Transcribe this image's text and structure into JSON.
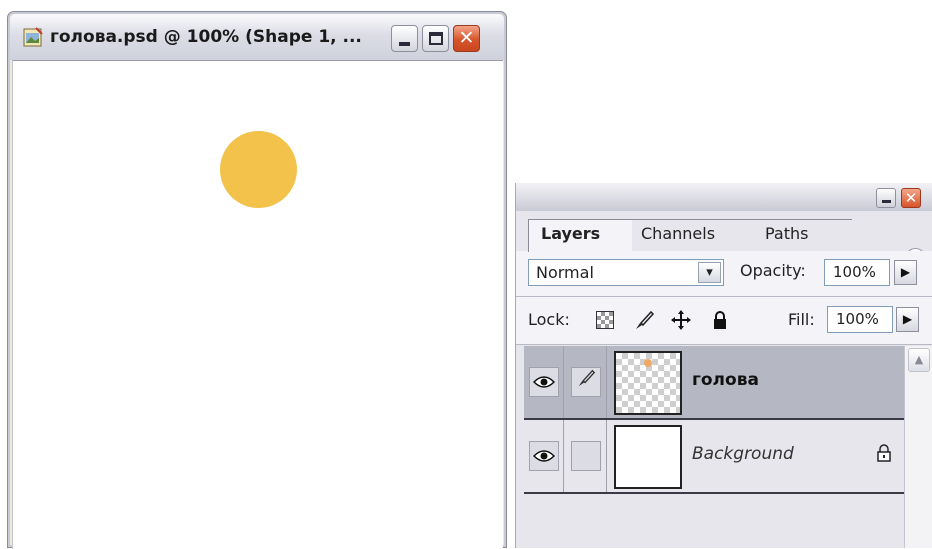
{
  "document": {
    "title": "голова.psd @ 100% (Shape 1, ...",
    "circle_color": "#f2c24a",
    "icons": {
      "app": "photoshop-document-icon",
      "minimize": "minimize-icon",
      "maximize": "maximize-icon",
      "close": "close-icon"
    }
  },
  "palette": {
    "tabs": [
      {
        "label": "Layers",
        "active": true
      },
      {
        "label": "Channels",
        "active": false
      },
      {
        "label": "Paths",
        "active": false
      }
    ],
    "blend_mode": "Normal",
    "blend_dropdown_glyph": "▾",
    "opacity_label": "Opacity:",
    "opacity_value": "100%",
    "lock_label": "Lock:",
    "fill_label": "Fill:",
    "fill_value": "100%",
    "arrow_glyph": "▶",
    "menu_glyph": "▶",
    "layers": [
      {
        "name": "голова",
        "selected": true,
        "visible": true
      },
      {
        "name": "Background",
        "selected": false,
        "visible": true,
        "locked": true
      }
    ]
  }
}
